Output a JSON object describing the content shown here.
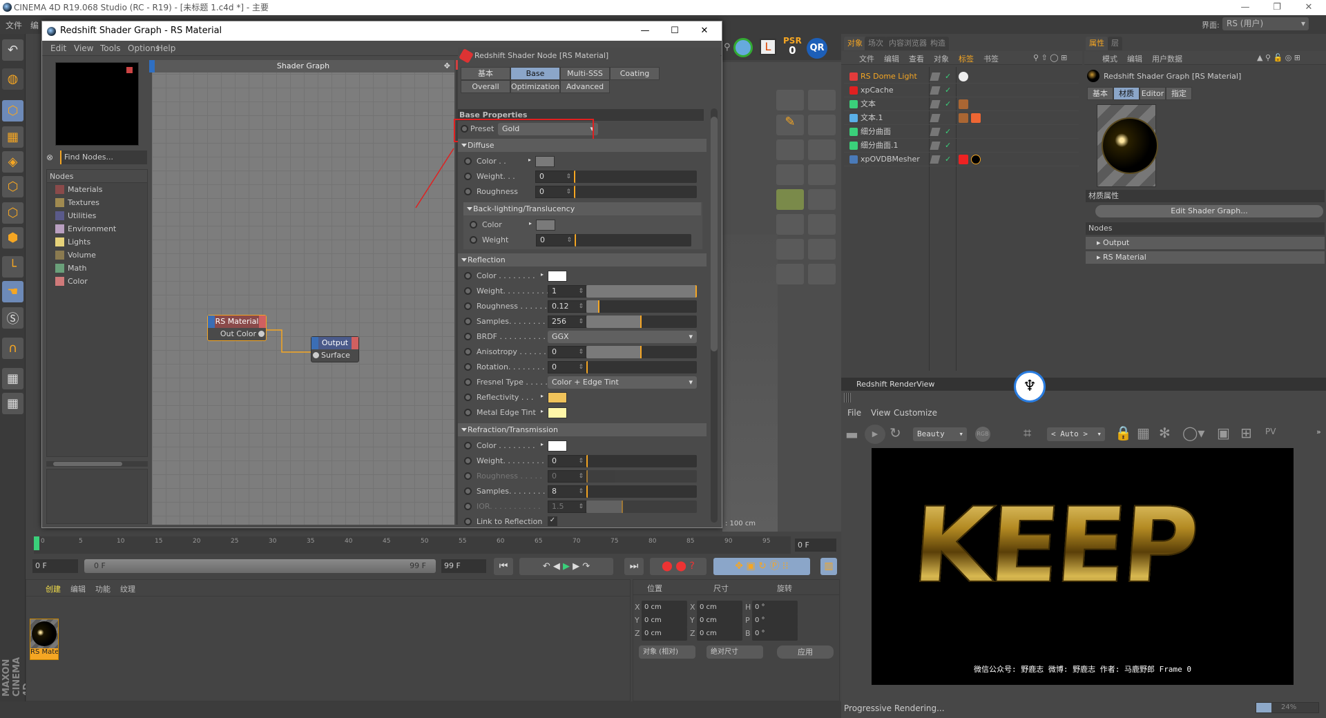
{
  "app_title": "CINEMA 4D R19.068 Studio (RC - R19) - [未标题 1.c4d *] - 主要",
  "main_menu": [
    "文件",
    "编"
  ],
  "layout_label": "界面:",
  "layout_value": "RS (用户)",
  "psr_label": "PSR",
  "psr_value": "0",
  "qr_label": "QR",
  "shader_window": {
    "title": "Redshift Shader Graph - RS Material",
    "menu": [
      "Edit",
      "View",
      "Tools",
      "Options",
      "Help"
    ],
    "find_placeholder": "Find Nodes...",
    "nodes_header": "Nodes",
    "node_categories": [
      {
        "label": "Materials",
        "color": "#8a4a4a"
      },
      {
        "label": "Textures",
        "color": "#a08a50"
      },
      {
        "label": "Utilities",
        "color": "#5a5a8a"
      },
      {
        "label": "Environment",
        "color": "#b99fc0"
      },
      {
        "label": "Lights",
        "color": "#e6d27a"
      },
      {
        "label": "Volume",
        "color": "#8a7a50"
      },
      {
        "label": "Math",
        "color": "#6aa07a"
      },
      {
        "label": "Color",
        "color": "#d07a7a"
      }
    ],
    "graph_title": "Shader Graph",
    "nodes": {
      "material": {
        "title": "RS Material",
        "port": "Out Color"
      },
      "output": {
        "title": "Output",
        "port": "Surface"
      }
    },
    "props": {
      "header": "Redshift Shader Node [RS Material]",
      "tabs_row1": [
        "基本",
        "Base Properties",
        "Multi-SSS",
        "Coating"
      ],
      "tabs_row2": [
        "Overall",
        "Optimizations",
        "Advanced"
      ],
      "active_tab": "Base Properties",
      "section": "Base Properties",
      "preset_label": "Preset",
      "preset_value": "Gold",
      "groups": [
        {
          "title": "Diffuse",
          "rows": [
            {
              "label": "Color . .",
              "type": "color",
              "color": "#7a7a7a"
            },
            {
              "label": "Weight. . .",
              "type": "num",
              "value": "0",
              "fill": 0
            },
            {
              "label": "Roughness",
              "type": "num",
              "value": "0",
              "fill": 0
            }
          ]
        },
        {
          "title": "Back-lighting/Translucency",
          "sub": true,
          "rows": [
            {
              "label": "Color",
              "type": "color",
              "color": "#7a7a7a"
            },
            {
              "label": "Weight",
              "type": "num",
              "value": "0",
              "fill": 0
            }
          ]
        },
        {
          "title": "Reflection",
          "rows": [
            {
              "label": "Color . . . . . . . .",
              "type": "color",
              "color": "#ffffff"
            },
            {
              "label": "Weight. . . . . . . . . .",
              "type": "num",
              "value": "1",
              "fill": 1
            },
            {
              "label": "Roughness . . . . . .",
              "type": "num",
              "value": "0.12",
              "fill": 0.12
            },
            {
              "label": "Samples. . . . . . . . .",
              "type": "num",
              "value": "256",
              "fill": 0.5
            },
            {
              "label": "BRDF . . . . . . . . . .",
              "type": "dd",
              "value": "GGX"
            },
            {
              "label": "Anisotropy . . . . . .",
              "type": "num",
              "value": "0",
              "fill": 0.5
            },
            {
              "label": "Rotation. . . . . . . . .",
              "type": "num",
              "value": "0",
              "fill": 0
            },
            {
              "label": "Fresnel Type . . . . .",
              "type": "dd",
              "value": "Color + Edge Tint"
            },
            {
              "label": "Reflectivity . . .",
              "type": "color",
              "color": "#f0c35a"
            },
            {
              "label": "Metal Edge Tint",
              "type": "color",
              "color": "#fff6a8"
            }
          ]
        },
        {
          "title": "Refraction/Transmission",
          "rows": [
            {
              "label": "Color . . . . . . . .",
              "type": "color",
              "color": "#ffffff"
            },
            {
              "label": "Weight. . . . . . . . .",
              "type": "num",
              "value": "0",
              "fill": 0
            },
            {
              "label": "Roughness . . . . .",
              "type": "num",
              "value": "0",
              "fill": 0,
              "disabled": true
            },
            {
              "label": "Samples. . . . . . . . .",
              "type": "num",
              "value": "8",
              "fill": 0
            },
            {
              "label": "IOR. . . . . . . . . . .",
              "type": "num",
              "value": "1.5",
              "fill": 0.33,
              "disabled": true
            },
            {
              "label": "Link to Reflection",
              "type": "check"
            }
          ]
        }
      ]
    }
  },
  "viewport": {
    "grid_spacing": ": 100 cm"
  },
  "object_manager": {
    "tabs": [
      "对象",
      "场次",
      "内容浏览器",
      "构造"
    ],
    "menu": [
      "文件",
      "编辑",
      "查看",
      "对象",
      "标签",
      "书签"
    ],
    "objects": [
      {
        "name": "RS Dome Light",
        "icon_color": "#e23b3b",
        "highlight": true
      },
      {
        "name": "xpCache",
        "icon_color": "#e02020"
      },
      {
        "name": "文本",
        "icon_color": "#3ad07a"
      },
      {
        "name": "文本.1",
        "icon_color": "#5ab0e8"
      },
      {
        "name": "细分曲面",
        "icon_color": "#3ad07a"
      },
      {
        "name": "细分曲面.1",
        "icon_color": "#3ad07a"
      },
      {
        "name": "xpOVDBMesher",
        "icon_color": "#4a7ab8"
      }
    ]
  },
  "attribute_manager": {
    "tabs": [
      "属性",
      "层"
    ],
    "menu": [
      "模式",
      "编辑",
      "用户数据"
    ],
    "title": "Redshift Shader Graph [RS Material]",
    "subtabs": [
      "基本",
      "材质",
      "Editor",
      "指定"
    ],
    "active_subtab": "材质",
    "section": "材质属性",
    "edit_button": "Edit Shader Graph...",
    "nodes_header": "Nodes",
    "nodes": [
      "Output",
      "RS Material"
    ]
  },
  "render_view": {
    "title": "Redshift RenderView",
    "menu": [
      "File",
      "View",
      "Customize"
    ],
    "aov": "Beauty",
    "rgb": "RGB",
    "zoom": "< Auto >",
    "render_text": "KEEP",
    "watermark": "微信公众号: 野鹿志   微博: 野鹿志   作者: 马鹿野郎  Frame  0",
    "status": "Progressive Rendering...",
    "progress": 24,
    "progress_label": "24%"
  },
  "timeline": {
    "ticks": [
      "0",
      "5",
      "10",
      "15",
      "20",
      "25",
      "30",
      "35",
      "40",
      "45",
      "50",
      "55",
      "60",
      "65",
      "70",
      "75",
      "80",
      "85",
      "90",
      "95"
    ],
    "current_frame": "0 F",
    "start": "0 F",
    "range_start": "0 F",
    "range_end": "99 F",
    "end": "99 F"
  },
  "material_manager": {
    "menu": [
      "创建",
      "编辑",
      "功能",
      "纹理"
    ],
    "materials": [
      "RS Mate"
    ]
  },
  "coord_manager": {
    "headers": [
      "位置",
      "尺寸",
      "旋转"
    ],
    "pos": [
      {
        "axis": "X",
        "value": "0 cm"
      },
      {
        "axis": "Y",
        "value": "0 cm"
      },
      {
        "axis": "Z",
        "value": "0 cm"
      }
    ],
    "size": [
      {
        "axis": "X",
        "value": "0 cm"
      },
      {
        "axis": "Y",
        "value": "0 cm"
      },
      {
        "axis": "Z",
        "value": "0 cm"
      }
    ],
    "rot": [
      {
        "axis": "H",
        "value": "0 °"
      },
      {
        "axis": "P",
        "value": "0 °"
      },
      {
        "axis": "B",
        "value": "0 °"
      }
    ],
    "mode": "对象 (相对)",
    "size_mode": "绝对尺寸",
    "apply": "应用"
  },
  "brand": "MAXON CINEMA 4D",
  "colors": {
    "accent": "#f5a623",
    "selection": "#8ba6c9",
    "annotation": "#e02020"
  }
}
